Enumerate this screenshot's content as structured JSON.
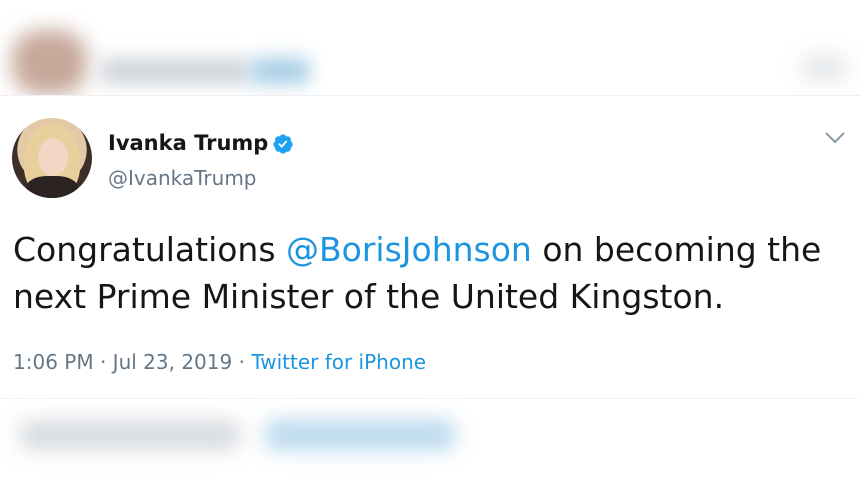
{
  "tweet": {
    "author_name": "Ivanka Trump",
    "author_handle": "@IvankaTrump",
    "verified": true,
    "text_before": "Congratulations ",
    "mention": "@BorisJohnson",
    "text_after": " on becoming the next Prime Minister of the United Kingston.",
    "time": "1:06 PM",
    "date": "Jul 23, 2019",
    "separator": " · ",
    "source": "Twitter for iPhone"
  },
  "icons": {
    "verified": "verified-badge-icon",
    "menu": "chevron-down-icon"
  },
  "colors": {
    "link": "#1b95e0",
    "secondary_text": "#657786",
    "primary_text": "#14171a"
  }
}
